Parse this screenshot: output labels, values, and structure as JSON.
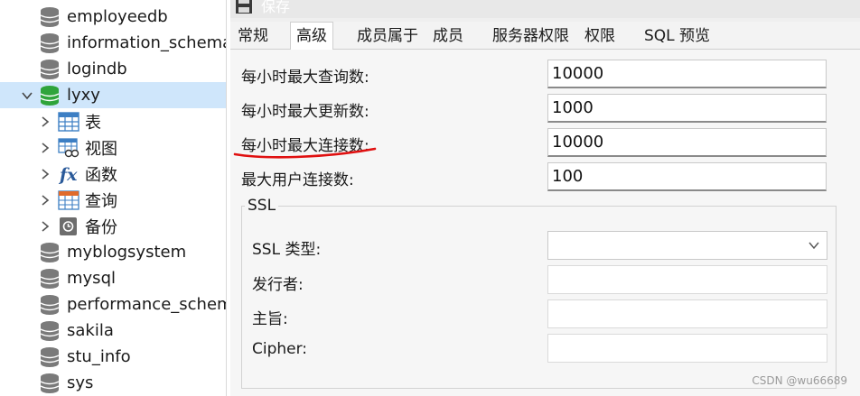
{
  "sidebar": {
    "databases_above": [
      "employeedb",
      "information_schema",
      "logindb"
    ],
    "selected_db": "lyxy",
    "children": [
      "表",
      "视图",
      "函数",
      "查询",
      "备份"
    ],
    "databases_below": [
      "myblogsystem",
      "mysql",
      "performance_schema",
      "sakila",
      "stu_info",
      "sys"
    ]
  },
  "toolbar": {
    "save_label": "保存"
  },
  "tabs": [
    "常规",
    "高级",
    "成员属于",
    "成员",
    "服务器权限",
    "权限",
    "SQL 预览"
  ],
  "active_tab": "高级",
  "advanced": {
    "max_queries_label": "每小时最大查询数:",
    "max_queries_value": "10000",
    "max_updates_label": "每小时最大更新数:",
    "max_updates_value": "1000",
    "max_connections_label": "每小时最大连接数:",
    "max_connections_value": "10000",
    "max_user_connections_label": "最大用户连接数:",
    "max_user_connections_value": "100"
  },
  "ssl": {
    "group_title": "SSL",
    "type_label": "SSL 类型:",
    "type_value": "",
    "issuer_label": "发行者:",
    "subject_label": "主旨:",
    "cipher_label": "Cipher:"
  },
  "colors": {
    "selection": "#cfe6fb",
    "db_icon": "#7a7a7a",
    "db_icon_selected": "#2fa43b",
    "annotation_red": "#e01010"
  },
  "icons": {
    "database": "database-icon",
    "table": "table-icon",
    "view": "view-icon",
    "function": "function-icon",
    "query": "query-icon",
    "backup": "backup-icon",
    "save": "save-icon",
    "dropdown": "chevron-down-icon"
  },
  "watermark": "CSDN @wu66689"
}
